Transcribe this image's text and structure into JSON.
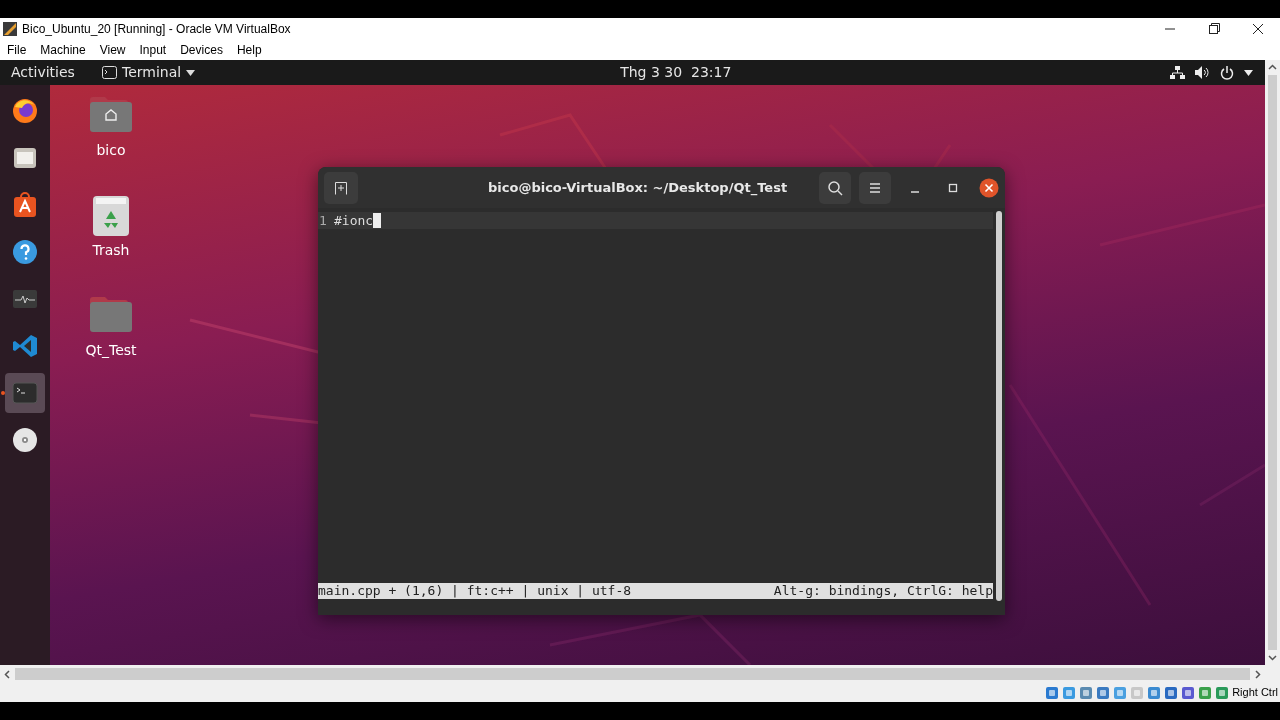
{
  "window": {
    "title": "Bico_Ubuntu_20 [Running] - Oracle VM VirtualBox"
  },
  "menu": [
    "File",
    "Machine",
    "View",
    "Input",
    "Devices",
    "Help"
  ],
  "top_bar": {
    "activities": "Activities",
    "app_menu": "Terminal",
    "clock": "Thg 3 30  23:17"
  },
  "dock": [
    {
      "kind": "firefox",
      "selected": false,
      "running": false
    },
    {
      "kind": "files",
      "selected": false,
      "running": false
    },
    {
      "kind": "software",
      "selected": false,
      "running": false
    },
    {
      "kind": "help",
      "selected": false,
      "running": false
    },
    {
      "kind": "monitor",
      "selected": false,
      "running": false
    },
    {
      "kind": "vscode",
      "selected": false,
      "running": false
    },
    {
      "kind": "terminal",
      "selected": true,
      "running": true
    },
    {
      "kind": "disc",
      "selected": false,
      "running": false
    }
  ],
  "desktop_icons": [
    {
      "kind": "home",
      "label": "bico"
    },
    {
      "kind": "trash",
      "label": "Trash"
    },
    {
      "kind": "folder",
      "label": "Qt_Test"
    }
  ],
  "terminal": {
    "title": "bico@bico-VirtualBox: ~/Desktop/Qt_Test",
    "lines": [
      {
        "number": "1",
        "text": "#ionc",
        "current": true
      }
    ],
    "status_left": "main.cpp + (1,6) | ft:c++ | unix | utf-8",
    "status_right": "Alt-g: bindings, CtrlG: help"
  },
  "status_bar": {
    "host_key": "Right Ctrl"
  }
}
